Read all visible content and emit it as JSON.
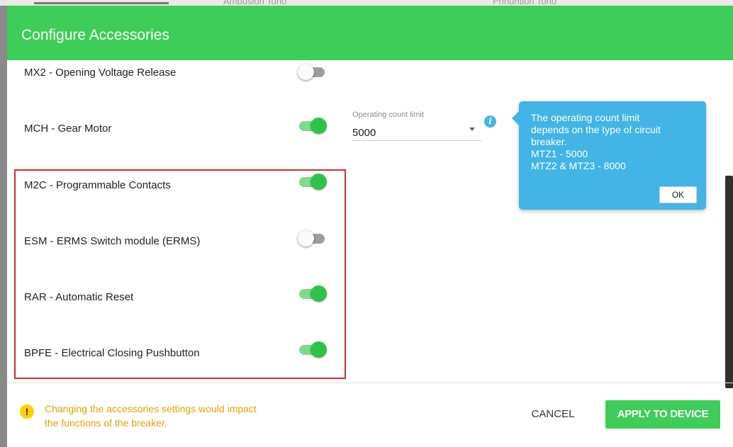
{
  "background": {
    "left_text": "Ambuslon Tono",
    "right_text": "Phnuntion Tono"
  },
  "dialog": {
    "title": "Configure Accessories"
  },
  "accessories": [
    {
      "label": "MX2 - Opening Voltage Release",
      "enabled": false
    },
    {
      "label": "MCH - Gear Motor",
      "enabled": true
    },
    {
      "label": "M2C - Programmable Contacts",
      "enabled": true
    },
    {
      "label": "ESM - ERMS Switch module (ERMS)",
      "enabled": false
    },
    {
      "label": "RAR - Automatic Reset",
      "enabled": true
    },
    {
      "label": "BPFE - Electrical Closing Pushbutton",
      "enabled": true
    }
  ],
  "operating_count": {
    "label": "Operating count limit",
    "value": "5000"
  },
  "tooltip": {
    "lines": [
      "The operating count limit",
      "depends on the type of circuit",
      "breaker.",
      "MTZ1 - 5000",
      "MTZ2 & MTZ3 - 8000"
    ],
    "ok_label": "OK"
  },
  "footer": {
    "warning_lines": [
      "Changing the accessories settings would impact",
      "the functions of the breaker."
    ],
    "cancel_label": "CANCEL",
    "apply_label": "APPLY TO DEVICE"
  },
  "colors": {
    "header": "#3dcd58",
    "toggle_on": "#2ec24a",
    "tooltip": "#42b4e6",
    "warning": "#e9a100",
    "highlight": "#d42c2c"
  },
  "icons": {
    "info": "info-icon",
    "warning": "warning-icon",
    "dropdown": "chevron-down-icon"
  }
}
